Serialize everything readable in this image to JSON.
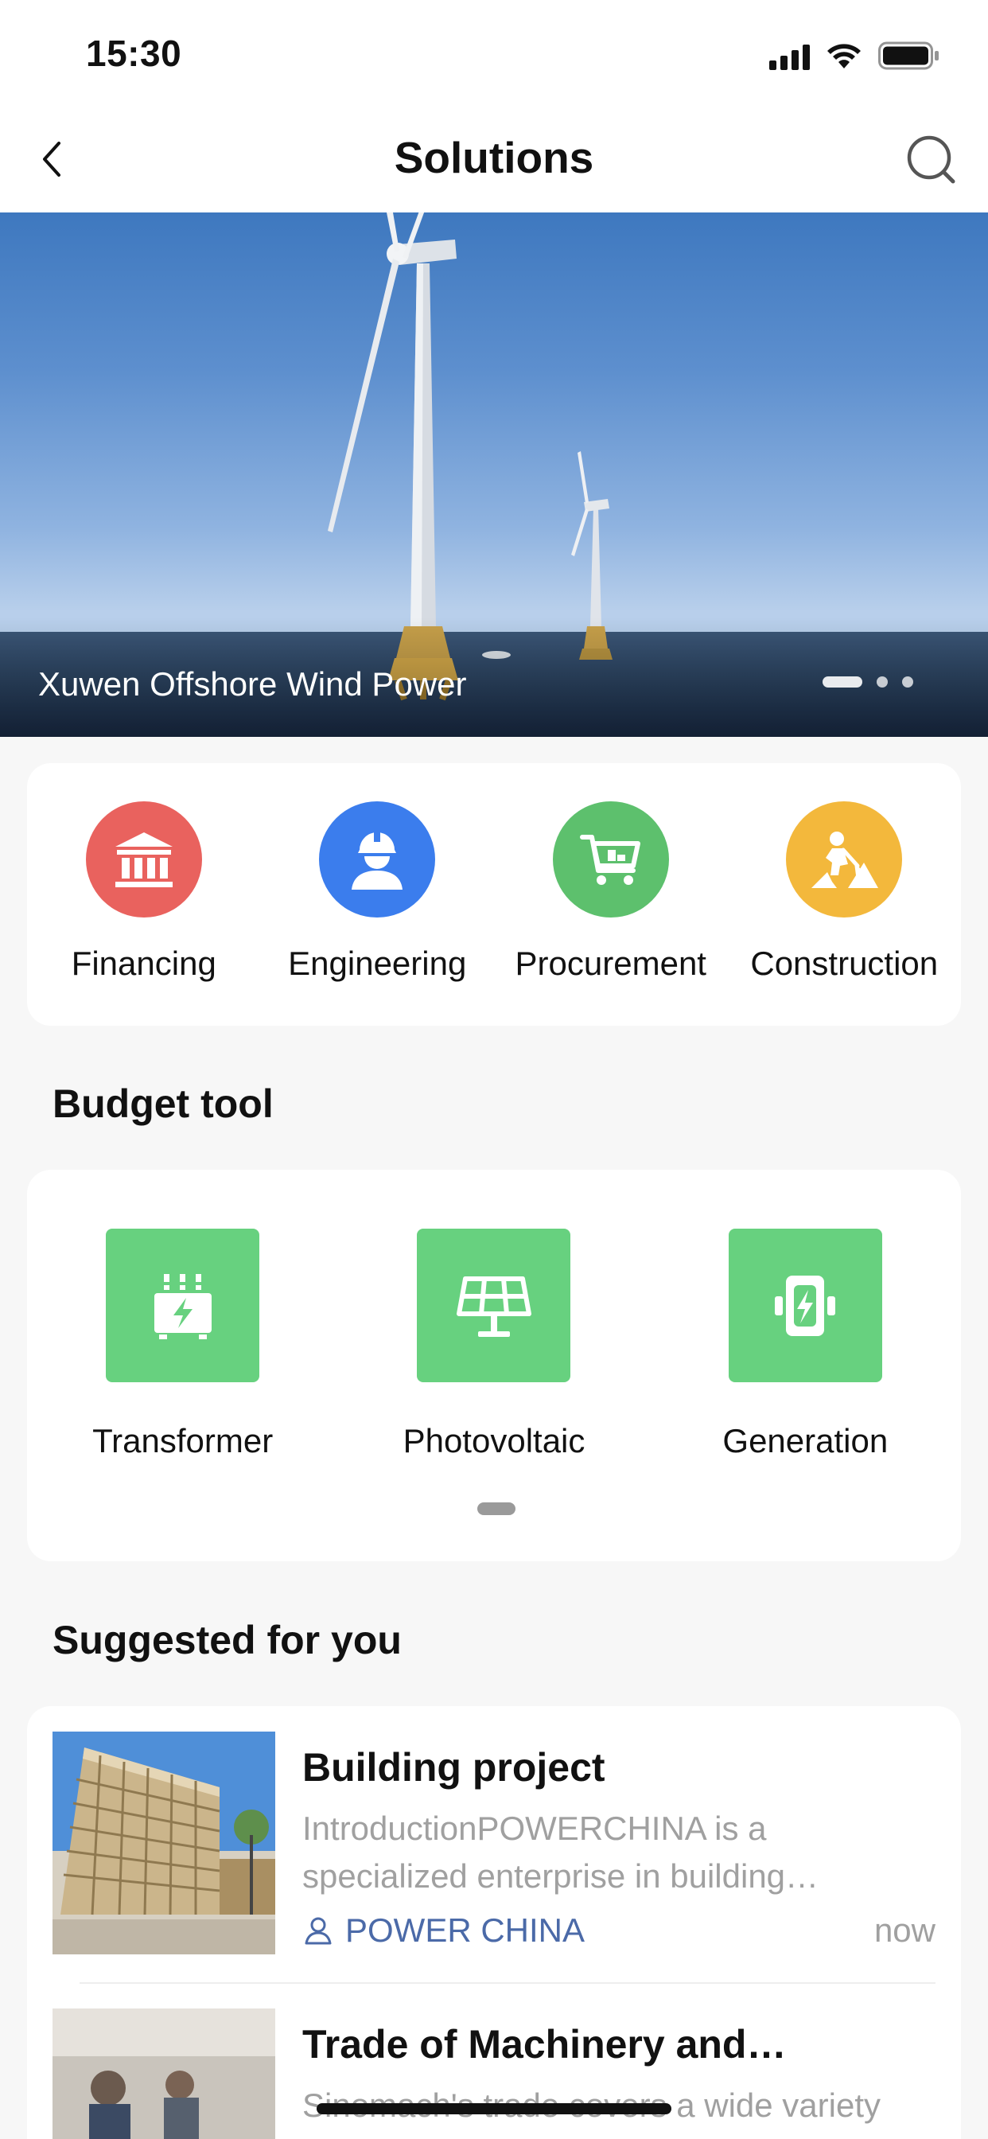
{
  "status_bar": {
    "time": "15:30"
  },
  "nav": {
    "title": "Solutions"
  },
  "hero": {
    "caption": "Xuwen Offshore Wind Power",
    "slide_count": 3,
    "active_slide": 1
  },
  "services": [
    {
      "label": "Financing",
      "icon": "bank-icon",
      "color": "#e9625e"
    },
    {
      "label": "Engineering",
      "icon": "engineer-icon",
      "color": "#3b7ded"
    },
    {
      "label": "Procurement",
      "icon": "shopping-cart-icon",
      "color": "#5dc06d"
    },
    {
      "label": "Construction",
      "icon": "construction-worker-icon",
      "color": "#f3b83c"
    }
  ],
  "budget": {
    "title": "Budget tool",
    "tools": [
      {
        "label": "Transformer",
        "icon": "transformer-icon"
      },
      {
        "label": "Photovoltaic",
        "icon": "solar-panel-icon"
      },
      {
        "label": "Generation",
        "icon": "generator-icon"
      }
    ],
    "accent": "#67d17f"
  },
  "suggested": {
    "title": "Suggested for you",
    "items": [
      {
        "title": "Building project",
        "desc_line1": "IntroductionPOWERCHINA is a",
        "desc_line2": "specialized enterprise in building…",
        "source": "POWER CHINA",
        "time": "now"
      },
      {
        "title": "Trade of Machinery and…",
        "desc_line1": "Sinomach's trade covers a wide variety"
      }
    ]
  }
}
